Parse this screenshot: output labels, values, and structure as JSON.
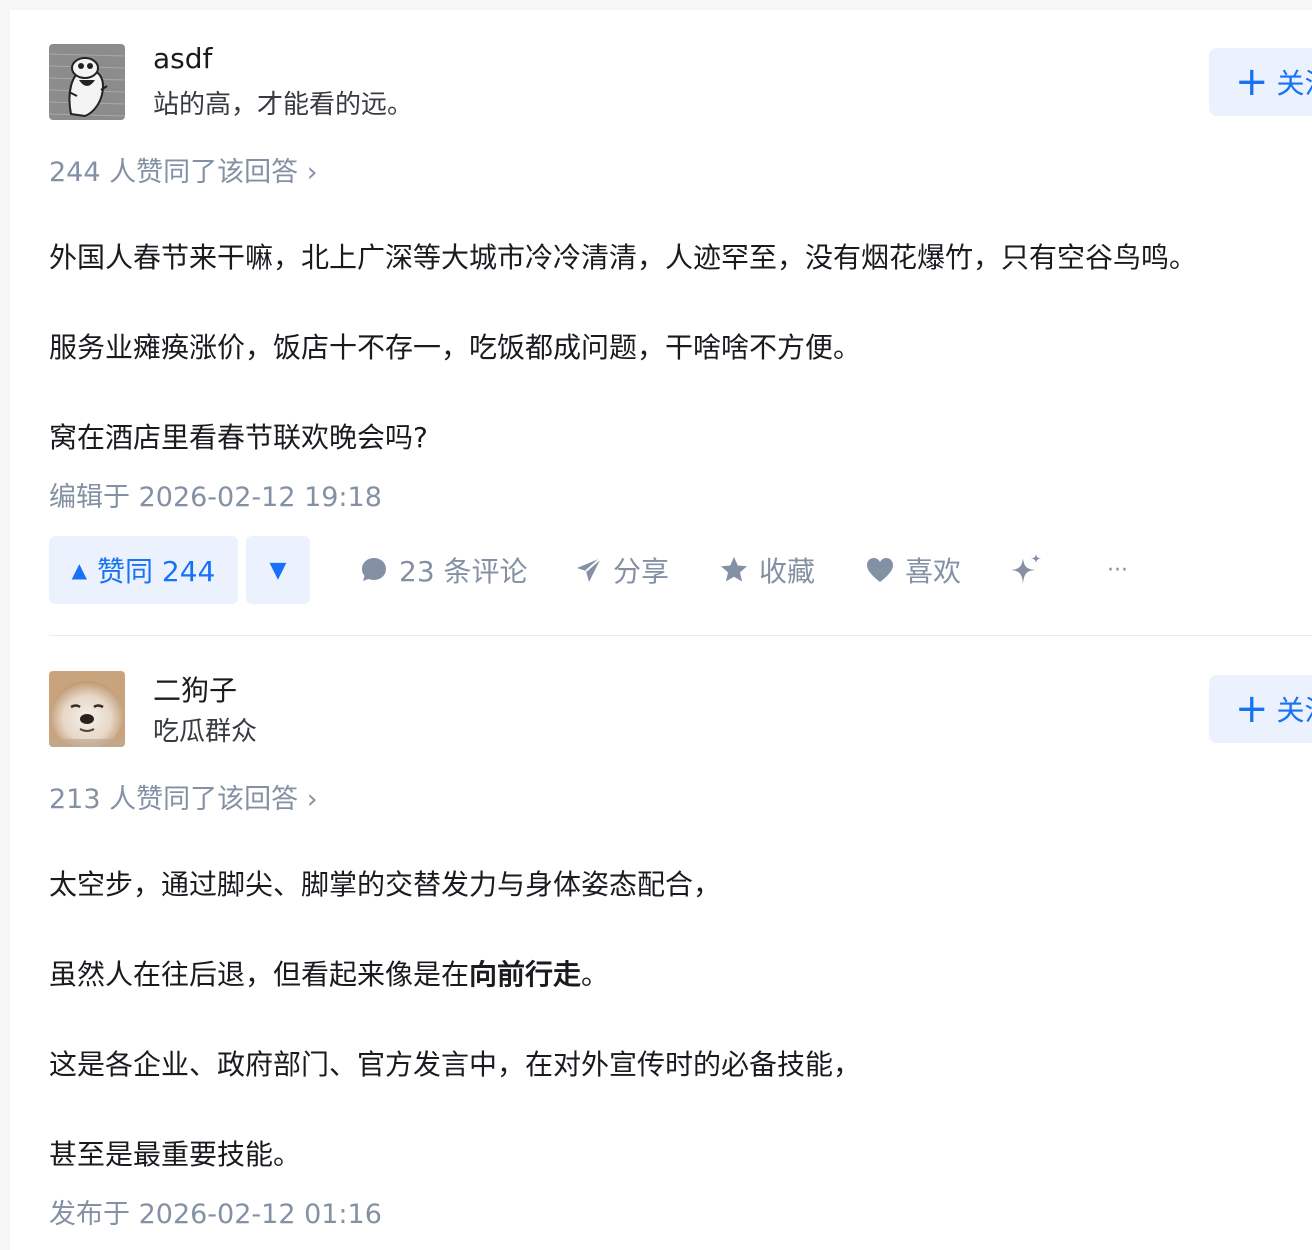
{
  "answers": [
    {
      "author_name": "asdf",
      "author_bio": "站的高，才能看的远。",
      "follow_label": "关注",
      "upvote_summary": "244 人赞同了该回答 ›",
      "paragraphs": [
        "外国人春节来干嘛，北上广深等大城市冷冷清清，人迹罕至，没有烟花爆竹，只有空谷鸟鸣。",
        "服务业瘫痪涨价，饭店十不存一，吃饭都成问题，干啥啥不方便。",
        "窝在酒店里看春节联欢晚会吗?"
      ],
      "time_label": "编辑于 2026-02-12 19:18",
      "vote_label": "赞同 244",
      "comments_label": "23 条评论",
      "share_label": "分享",
      "favorite_label": "收藏",
      "like_label": "喜欢",
      "more_label": "···"
    },
    {
      "author_name": "二狗子",
      "author_bio": "吃瓜群众",
      "follow_label": "关注",
      "upvote_summary": "213 人赞同了该回答 ›",
      "paragraphs": [
        "太空步，通过脚尖、脚掌的交替发力与身体姿态配合，",
        "虽然人在往后退，但看起来像是在",
        "向前行走",
        "。",
        "这是各企业、政府部门、官方发言中，在对外宣传时的必备技能，",
        "甚至是最重要技能。"
      ],
      "time_label": "发布于 2026-02-12 01:16"
    }
  ],
  "icons": {
    "plus": "plus-icon",
    "up": "triangle-up-icon",
    "down": "triangle-down-icon",
    "comment": "comment-bubble-icon",
    "share": "paper-plane-icon",
    "favorite": "star-icon",
    "like": "heart-icon",
    "ai": "sparkle-icon",
    "more": "ellipsis-icon"
  },
  "colors": {
    "accent": "#1772f6",
    "accent_bg": "#ebf2fe",
    "muted": "#8491a5"
  }
}
